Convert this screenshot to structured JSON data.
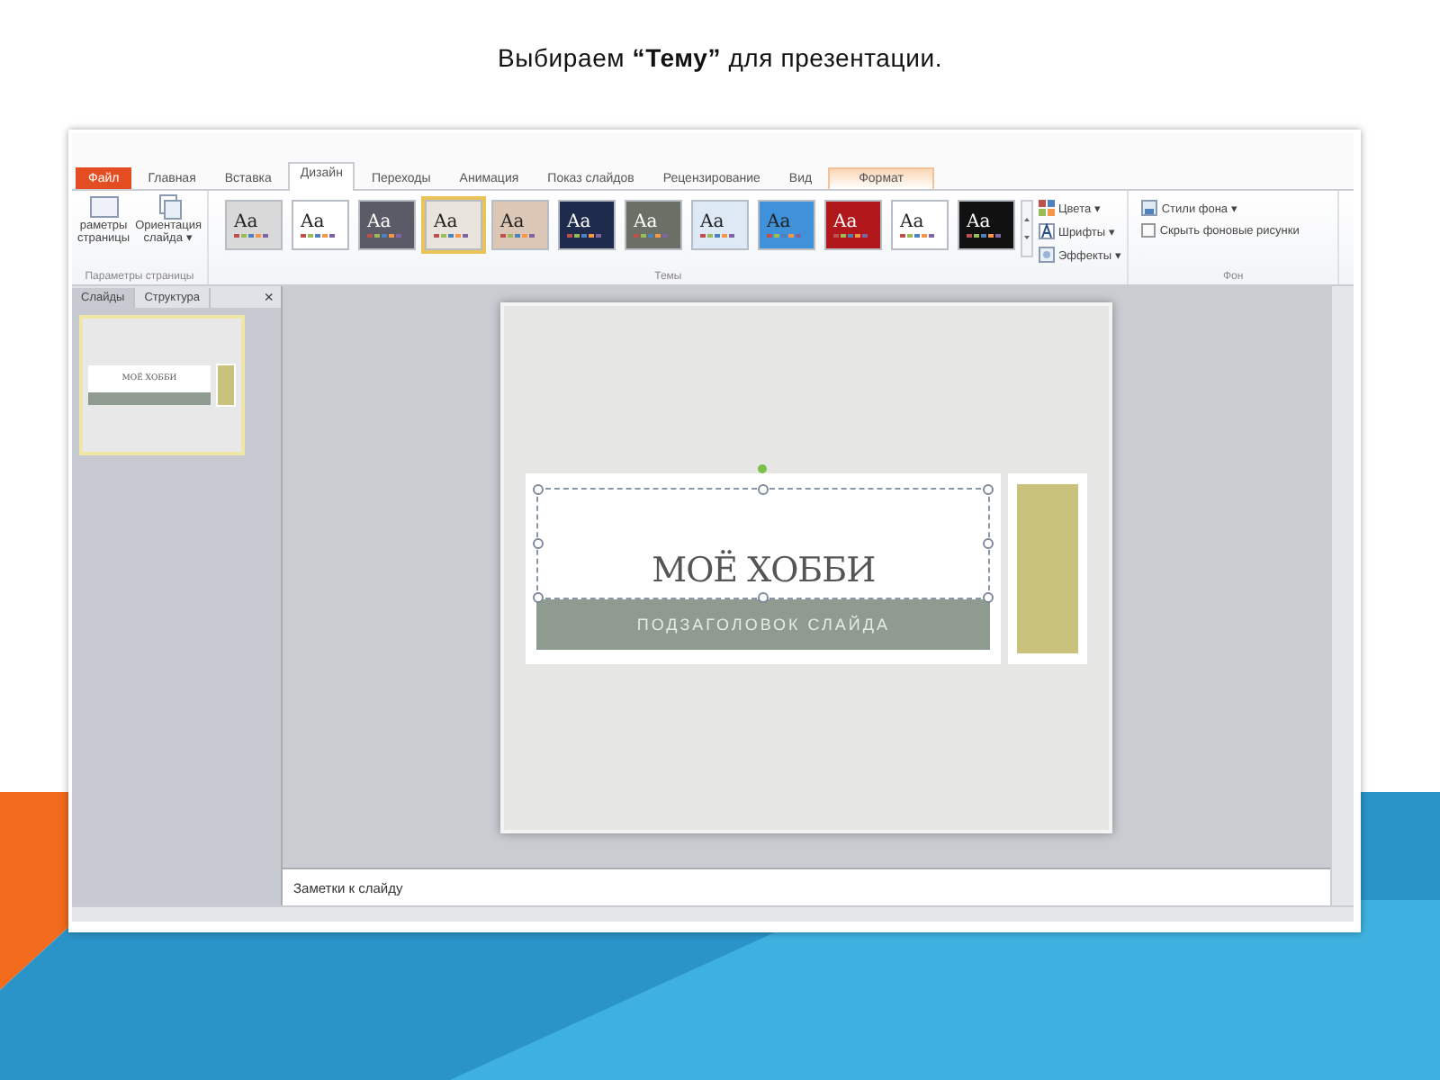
{
  "caption": "Выбираем **“Тему”** для презентации.",
  "window": {
    "tabs": [
      {
        "label": "Файл",
        "kind": "file",
        "selected": false
      },
      {
        "label": "Главная",
        "kind": "tab",
        "selected": false
      },
      {
        "label": "Вставка",
        "kind": "tab",
        "selected": false
      },
      {
        "label": "Дизайн",
        "kind": "tab",
        "selected": true
      },
      {
        "label": "Переходы",
        "kind": "tab",
        "selected": false
      },
      {
        "label": "Анимация",
        "kind": "tab",
        "selected": false
      },
      {
        "label": "Показ слайдов",
        "kind": "tab",
        "selected": false
      },
      {
        "label": "Рецензирование",
        "kind": "tab",
        "selected": false
      },
      {
        "label": "Вид",
        "kind": "tab",
        "selected": false
      },
      {
        "label": "Формат",
        "kind": "context",
        "selected": false
      }
    ],
    "page_setup": {
      "buttons": [
        "раметры\nстраницы",
        "Ориентация\nслайда ▾"
      ],
      "label": "Параметры страницы"
    },
    "themes": {
      "items": [
        {
          "label": "Aa",
          "color": "#d9d9d9",
          "selected": false
        },
        {
          "label": "Aa",
          "color": "#ffffff",
          "selected": false
        },
        {
          "label": "Aa",
          "color": "#5b5b68",
          "selected": false
        },
        {
          "label": "Aa",
          "color": "#e9e5dc",
          "selected": true
        },
        {
          "label": "Aa",
          "color": "#dcc7b6",
          "selected": false
        },
        {
          "label": "Aa",
          "color": "#1f2b4d",
          "selected": false
        },
        {
          "label": "Aa",
          "color": "#6b7067",
          "selected": false
        },
        {
          "label": "Aa",
          "color": "#dde9f5",
          "selected": false
        },
        {
          "label": "Aa",
          "color": "#3f91d9",
          "selected": false
        },
        {
          "label": "Aa",
          "color": "#b0181b",
          "selected": false
        },
        {
          "label": "Aa",
          "color": "#ffffff",
          "selected": false
        },
        {
          "label": "Aa",
          "color": "#111111",
          "selected": false
        }
      ],
      "options": [
        "Цвета ▾",
        "Шрифты ▾",
        "Эффекты ▾"
      ],
      "label": "Темы"
    },
    "background": {
      "styles": "Стили фона ▾",
      "hide_graphics": {
        "label": "Скрыть фоновые рисунки",
        "checked": false
      },
      "label": "Фон"
    },
    "panel_tabs": [
      {
        "label": "Слайды",
        "selected": true
      },
      {
        "label": "Структура",
        "selected": false
      }
    ],
    "panel_close": "×",
    "thumbnail": {
      "title": "МОЁ ХОББИ"
    },
    "slide": {
      "title": "МОЁ ХОББИ",
      "subtitle": "ПОДЗАГОЛОВОК СЛАЙДА"
    },
    "notes": {
      "placeholder": "Заметки к слайду"
    }
  }
}
